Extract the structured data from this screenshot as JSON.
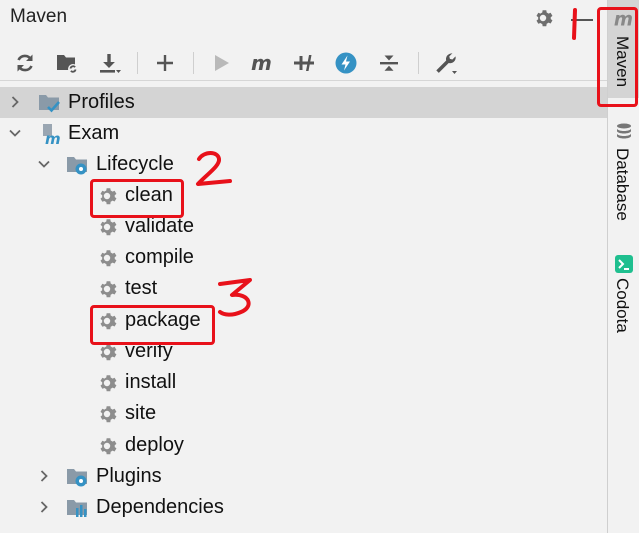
{
  "panel": {
    "title": "Maven"
  },
  "tree": {
    "profiles": "Profiles",
    "project": "Exam",
    "lifecycle": "Lifecycle",
    "phases": [
      "clean",
      "validate",
      "compile",
      "test",
      "package",
      "verify",
      "install",
      "site",
      "deploy"
    ],
    "plugins": "Plugins",
    "dependencies": "Dependencies"
  },
  "sidebar": {
    "tabs": [
      "Maven",
      "Database",
      "Codota"
    ]
  },
  "annotations": {
    "marks": [
      "1",
      "2",
      "3"
    ],
    "color": "#e8111a"
  },
  "colors": {
    "accent": "#3592c4",
    "selection": "#d4d4d4"
  }
}
